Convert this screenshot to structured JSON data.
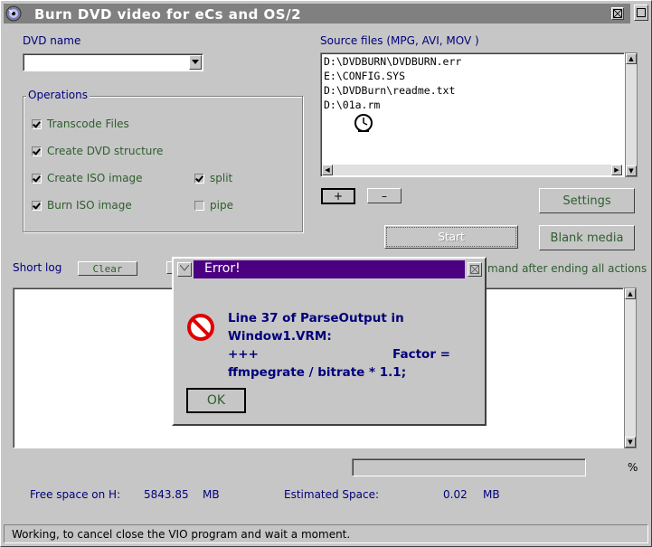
{
  "window": {
    "title": "Burn DVD video for eCs and OS/2"
  },
  "dvd_name": {
    "label": "DVD name",
    "value": ""
  },
  "source_files": {
    "label": "Source files (MPG, AVI, MOV )",
    "items": [
      "D:\\DVDBURN\\DVDBURN.err",
      "E:\\CONFIG.SYS",
      "D:\\DVDBurn\\readme.txt",
      "D:\\01a.rm"
    ]
  },
  "operations": {
    "title": "Operations",
    "transcode": "Transcode Files",
    "create_dvd": "Create DVD structure",
    "create_iso": "Create ISO image",
    "burn_iso": "Burn ISO image",
    "split": "split",
    "pipe": "pipe"
  },
  "buttons": {
    "add": "+",
    "remove": "–",
    "settings": "Settings",
    "start": "Start",
    "blank_media": "Blank media",
    "clear": "Clear",
    "ok": "OK"
  },
  "log": {
    "label": "Short log",
    "command_after": "mand after ending all actions"
  },
  "dialog": {
    "title": "Error!",
    "line1": "Line 37 of ParseOutput in",
    "line2": "Window1.VRM:",
    "line3a": "+++",
    "line3b": "Factor =",
    "line4": "ffmpegrate / bitrate * 1.1;"
  },
  "progress": {
    "percent_symbol": "%",
    "value": 0
  },
  "space": {
    "free_label": "Free space on H:",
    "free_value": "5843.85",
    "free_unit": "MB",
    "est_label": "Estimated Space:",
    "est_value": "0.02",
    "est_unit": "MB"
  },
  "status": {
    "text": "Working, to cancel close the VIO program and wait a moment."
  },
  "colors": {
    "titlebar": "#808080",
    "dialog_title": "#4b0082",
    "label": "#00007b",
    "check_label": "#2e5e2e"
  }
}
